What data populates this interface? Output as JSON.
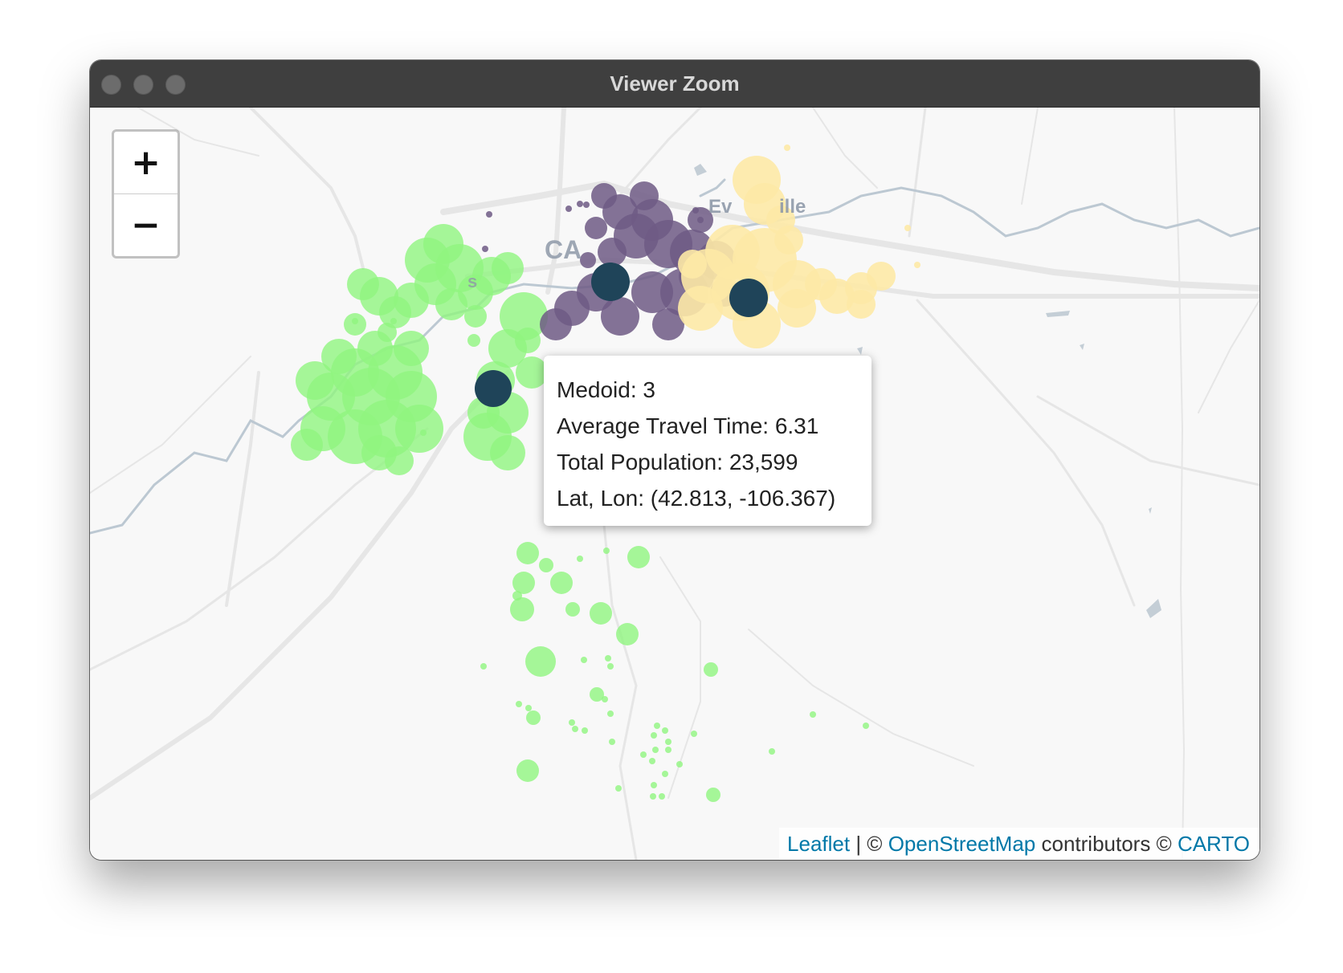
{
  "window": {
    "title": "Viewer Zoom"
  },
  "zoom": {
    "in_label": "+",
    "out_label": "−"
  },
  "map_labels": {
    "city_left": "CA",
    "city_left_suffix": "s",
    "city_right": "Ev",
    "city_right_suffix": "ille"
  },
  "popup": {
    "medoid": "Medoid: 3",
    "travel_time": "Average Travel Time: 6.31",
    "population": "Total Population: 23,599",
    "latlon": "Lat, Lon: (42.813, -106.367)"
  },
  "attribution": {
    "leaflet": "Leaflet",
    "sep": " | © ",
    "osm": "OpenStreetMap",
    "contrib": " contributors © ",
    "carto": "CARTO"
  },
  "colors": {
    "cluster_green": "#90f57f",
    "cluster_purple": "#6e5a85",
    "cluster_yellow": "#fde9a6",
    "medoid": "#1f4459",
    "water": "#b9c5cf",
    "road": "#e4e4e4"
  }
}
